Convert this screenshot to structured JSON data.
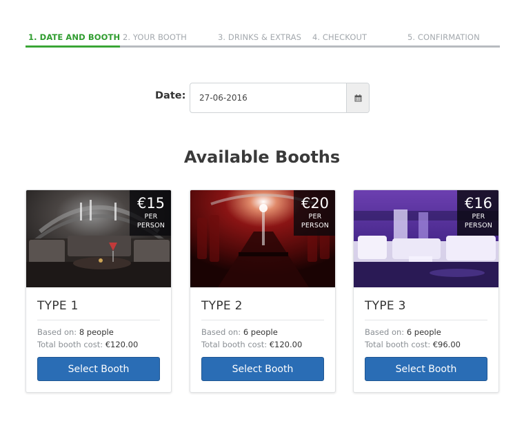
{
  "steps": [
    {
      "label": "1. DATE AND BOOTH"
    },
    {
      "label": "2. YOUR BOOTH"
    },
    {
      "label": "3. DRINKS & EXTRAS"
    },
    {
      "label": "4. CHECKOUT"
    },
    {
      "label": "5. CONFIRMATION"
    }
  ],
  "step_progress": {
    "active_index": 0
  },
  "date": {
    "label": "Date:",
    "value": "27-06-2016",
    "icon": "calendar-icon"
  },
  "heading": "Available Booths",
  "booths": [
    {
      "price": "€15",
      "per_line1": "PER",
      "per_line2": "PERSON",
      "title": "TYPE 1",
      "based_label": "Based on:",
      "based_value": "8 people",
      "total_label": "Total booth cost:",
      "total_value": "€120.00",
      "button": "Select Booth"
    },
    {
      "price": "€20",
      "per_line1": "PER",
      "per_line2": "PERSON",
      "title": "TYPE 2",
      "based_label": "Based on:",
      "based_value": "6 people",
      "total_label": "Total booth cost:",
      "total_value": "€120.00",
      "button": "Select Booth"
    },
    {
      "price": "€16",
      "per_line1": "PER",
      "per_line2": "PERSON",
      "title": "TYPE 3",
      "based_label": "Based on:",
      "based_value": "6 people",
      "total_label": "Total booth cost:",
      "total_value": "€96.00",
      "button": "Select Booth"
    }
  ],
  "colors": {
    "active_step": "#3aa535",
    "inactive_step": "#b7bbbf",
    "primary_button": "#2a6db5"
  }
}
